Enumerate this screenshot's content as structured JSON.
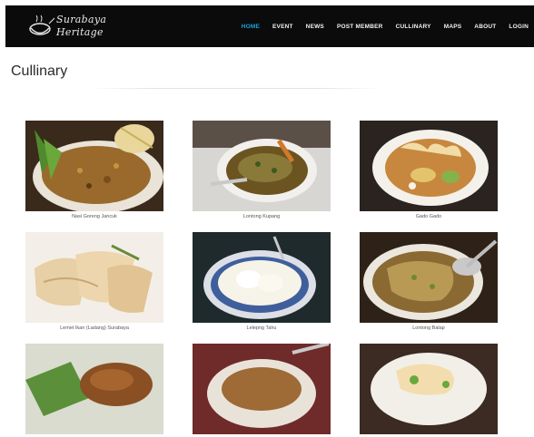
{
  "brand": {
    "line1": "Surabaya",
    "line2": "Heritage"
  },
  "nav": {
    "items": [
      {
        "label": "HOME",
        "active": true
      },
      {
        "label": "EVENT",
        "active": false
      },
      {
        "label": "NEWS",
        "active": false
      },
      {
        "label": "POST MEMBER",
        "active": false
      },
      {
        "label": "CULLINARY",
        "active": false
      },
      {
        "label": "MAPS",
        "active": false
      },
      {
        "label": "ABOUT",
        "active": false
      },
      {
        "label": "LOGIN",
        "active": false
      }
    ],
    "active_color": "#19a3dd"
  },
  "page": {
    "title": "Cullinary"
  },
  "dishes": [
    {
      "caption": "Nasi Goreng Jancuk"
    },
    {
      "caption": "Lontong Kupang"
    },
    {
      "caption": "Gado Gado"
    },
    {
      "caption": "Lemet Ikan (Ladang) Surabaya"
    },
    {
      "caption": "Lelepng Tahu"
    },
    {
      "caption": "Lontong Balap"
    },
    {
      "caption": ""
    },
    {
      "caption": ""
    },
    {
      "caption": ""
    }
  ]
}
